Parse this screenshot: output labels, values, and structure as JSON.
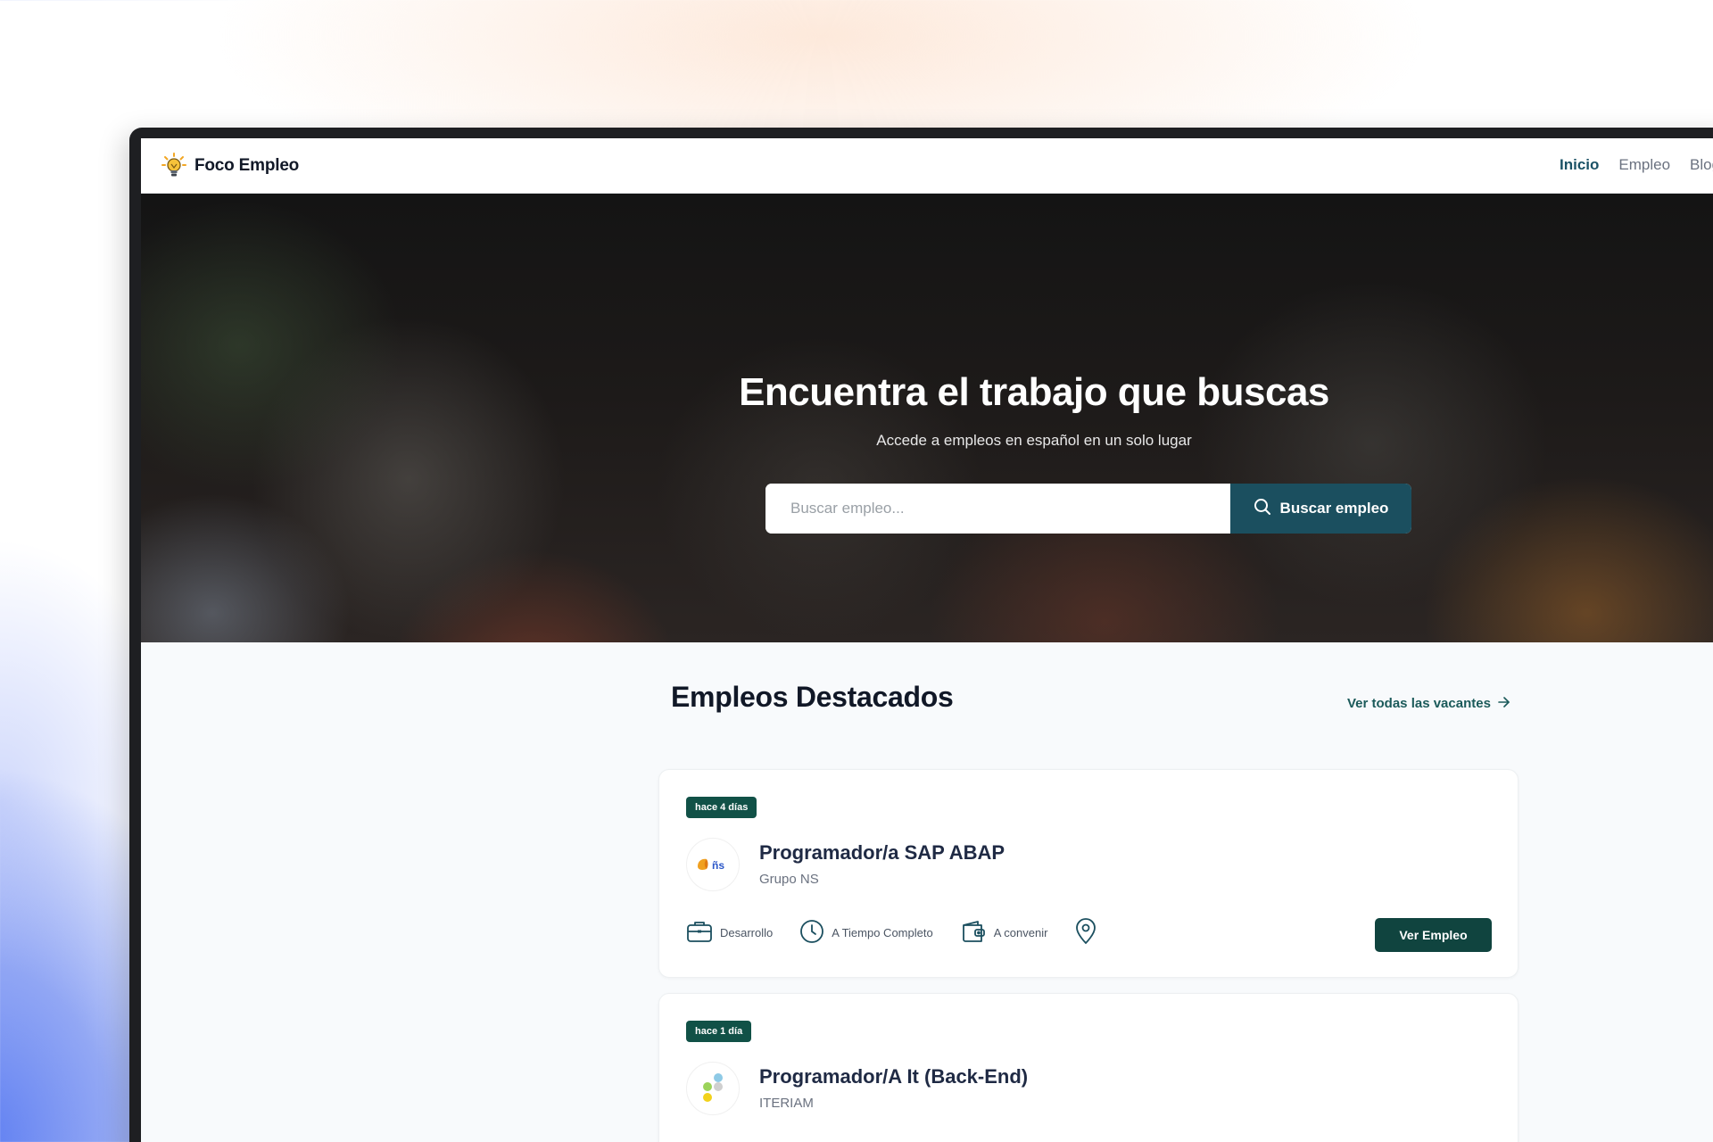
{
  "brand": {
    "name": "Foco Empleo",
    "icon": "lightbulb-icon"
  },
  "nav": {
    "items": [
      {
        "label": "Inicio",
        "active": true
      },
      {
        "label": "Empleo",
        "active": false
      },
      {
        "label": "Blog",
        "active": false
      }
    ]
  },
  "hero": {
    "title": "Encuentra el trabajo que buscas",
    "subtitle": "Accede a empleos en español en un solo lugar",
    "search": {
      "placeholder": "Buscar empleo...",
      "button_label": "Buscar empleo",
      "icon": "search-icon"
    }
  },
  "featured": {
    "title": "Empleos Destacados",
    "view_all_label": "Ver todas las vacantes",
    "jobs": [
      {
        "age_badge": "hace 4 días",
        "title": "Programador/a SAP ABAP",
        "company": "Grupo NS",
        "category": "Desarrollo",
        "schedule": "A Tiempo Completo",
        "salary": "A convenir",
        "button_label": "Ver Empleo"
      },
      {
        "age_badge": "hace 1 día",
        "title": "Programador/A It (Back-End)",
        "company": "ITERIAM"
      }
    ]
  },
  "colors": {
    "primary": "#1b4f5f",
    "badge": "#115147",
    "nav_active": "#1b5266",
    "title_text": "#1f2a44"
  }
}
